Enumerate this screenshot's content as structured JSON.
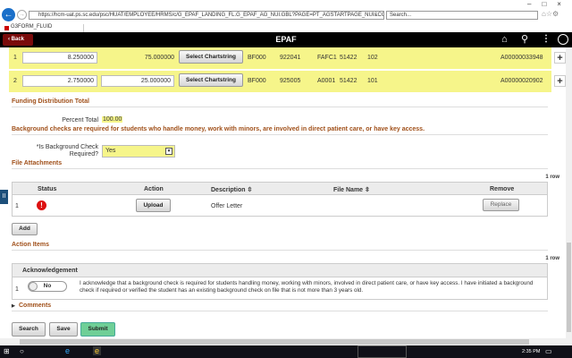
{
  "browser": {
    "url": "https://hcm-uat.ps.sc.edu/psc/HUAT/EMPLOYEE/HRMS/c/G_EPAF_LANDING_FL.G_EPAF_AG_NUI.GBL?PAGE=PT_AGSTARTPAGE_NUI&CONTEXTIDPARAM",
    "search_placeholder": "Search...",
    "tab_title": "G3FORM_FLUID"
  },
  "header": {
    "back_label": "Back",
    "title": "EPAF"
  },
  "funding_rows": [
    {
      "index": "1",
      "pct1": "8.250000",
      "pct2": "75.000000",
      "pct2_editable": false,
      "button": "Select Chartstring",
      "fund": "BF000",
      "dept": "922041",
      "prog": "FAFC1",
      "acct": "51422",
      "cls": "102",
      "id": "A00000033948"
    },
    {
      "index": "2",
      "pct1": "2.750000",
      "pct2": "25.000000",
      "pct2_editable": true,
      "button": "Select Chartstring",
      "fund": "BF000",
      "dept": "925005",
      "prog": "A0001",
      "acct": "51422",
      "cls": "101",
      "id": "A00000020902"
    }
  ],
  "funding_total": {
    "heading": "Funding Distribution Total",
    "label": "Percent Total",
    "value": "100.00"
  },
  "background_notice": "Background checks are required for students who handle money, work with minors, are involved in direct patient care, or have key access.",
  "background_check": {
    "label1": "*Is Background Check",
    "label2": "Required?",
    "value": "Yes"
  },
  "attachments": {
    "heading": "File Attachments",
    "count": "1 row",
    "columns": [
      "Status",
      "Action",
      "Description",
      "File Name",
      "Remove"
    ],
    "rows": [
      {
        "index": "1",
        "status": "error",
        "action": "Upload",
        "description": "Offer Letter",
        "file_name": "",
        "remove": "Replace"
      }
    ],
    "add_label": "Add"
  },
  "action_items": {
    "heading": "Action Items",
    "count": "1 row",
    "column": "Acknowledgement",
    "rows": [
      {
        "index": "1",
        "toggle": "No",
        "text": "I acknowledge that a background check is required for students handling money, working with minors, involved in direct patient care, or have key access.  I have initiated a background check if required or verified the student has an existing background check on file that is not more than 3 years old."
      }
    ]
  },
  "comments_label": "Comments",
  "footer": {
    "search": "Search",
    "save": "Save",
    "submit": "Submit"
  },
  "taskbar": {
    "time": "2:35 PM"
  },
  "colors": {
    "highlight": "#f6f58a",
    "section": "#a0501a",
    "submit": "#6fcf97",
    "header": "#000000",
    "back": "#7a0b0b"
  }
}
